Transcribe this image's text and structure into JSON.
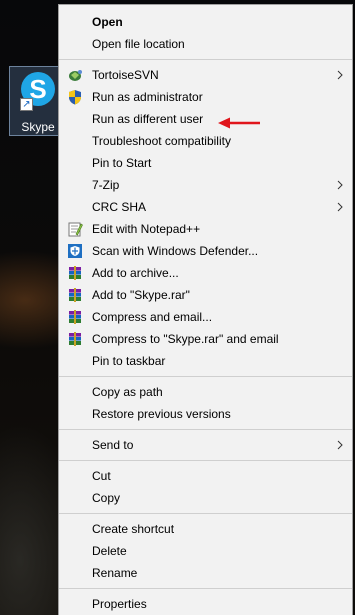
{
  "desktop": {
    "shortcut_label": "Skype"
  },
  "menu": {
    "items": [
      {
        "label": "Open",
        "bold": true
      },
      {
        "label": "Open file location"
      },
      {
        "label": "TortoiseSVN",
        "icon": "tortoisesvn-icon",
        "submenu": true
      },
      {
        "label": "Run as administrator",
        "icon": "uac-shield-icon"
      },
      {
        "label": "Run as different user"
      },
      {
        "label": "Troubleshoot compatibility"
      },
      {
        "label": "Pin to Start"
      },
      {
        "label": "7-Zip",
        "submenu": true
      },
      {
        "label": "CRC SHA",
        "submenu": true
      },
      {
        "label": "Edit with Notepad++",
        "icon": "notepadpp-icon"
      },
      {
        "label": "Scan with Windows Defender...",
        "icon": "windows-defender-icon"
      },
      {
        "label": "Add to archive...",
        "icon": "winrar-icon"
      },
      {
        "label": "Add to \"Skype.rar\"",
        "icon": "winrar-icon"
      },
      {
        "label": "Compress and email...",
        "icon": "winrar-icon"
      },
      {
        "label": "Compress to \"Skype.rar\" and email",
        "icon": "winrar-icon"
      },
      {
        "label": "Pin to taskbar"
      },
      {
        "label": "Copy as path"
      },
      {
        "label": "Restore previous versions"
      },
      {
        "label": "Send to",
        "submenu": true
      },
      {
        "label": "Cut"
      },
      {
        "label": "Copy"
      },
      {
        "label": "Create shortcut"
      },
      {
        "label": "Delete"
      },
      {
        "label": "Rename"
      },
      {
        "label": "Properties"
      }
    ]
  },
  "annotation": {
    "arrow_color": "#e0151b",
    "points_to": "Run as different user"
  },
  "colors": {
    "menu_background": "#f2f2f2",
    "separator": "#cfcfcf",
    "skype_blue": "#1fa6e6"
  }
}
